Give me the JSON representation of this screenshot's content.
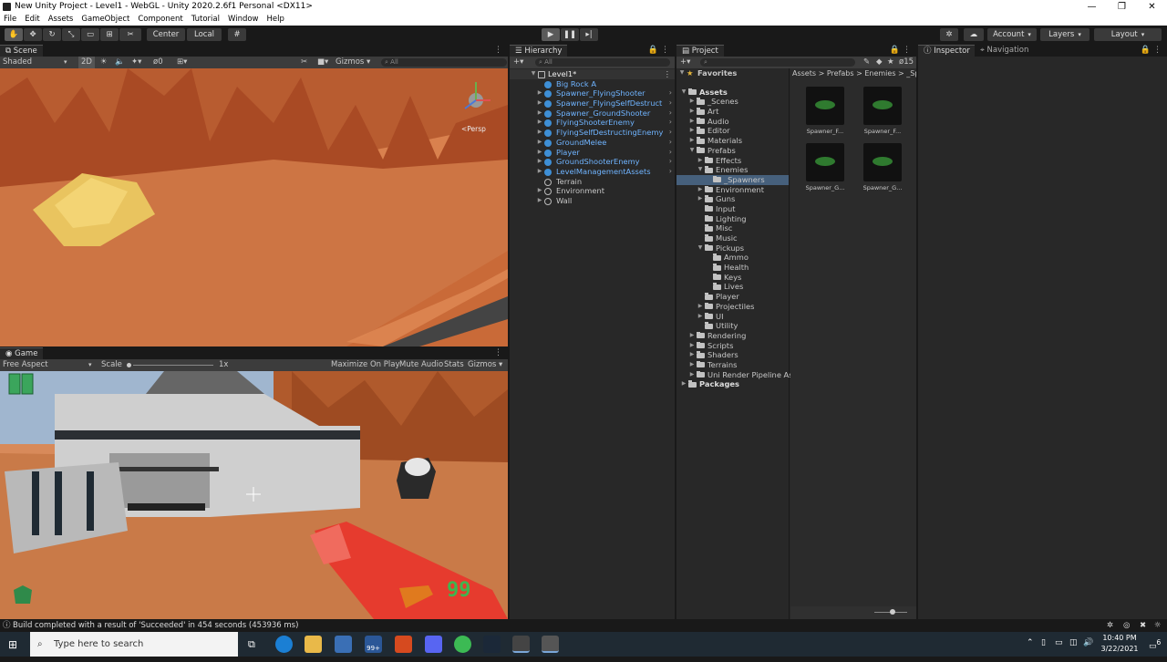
{
  "window": {
    "title": "New Unity Project - Level1 - WebGL - Unity 2020.2.6f1 Personal <DX11>",
    "controls": [
      "—",
      "❐",
      "✕"
    ]
  },
  "menu": [
    "File",
    "Edit",
    "Assets",
    "GameObject",
    "Component",
    "Tutorial",
    "Window",
    "Help"
  ],
  "toolbar": {
    "pivot_center": "Center",
    "pivot_local": "Local",
    "account": "Account",
    "layers": "Layers",
    "layout": "Layout"
  },
  "scene": {
    "tab": "Scene",
    "shading": "Shaded",
    "mode_2d": "2D",
    "hidden_count": "0",
    "gizmos": "Gizmos",
    "search_placeholder": "All",
    "persp": "<Persp"
  },
  "game": {
    "tab": "Game",
    "aspect": "Free Aspect",
    "scale_label": "Scale",
    "scale_value": "1x",
    "maximize": "Maximize On Play",
    "mute": "Mute Audio",
    "stats": "Stats",
    "gizmos": "Gizmos",
    "ammo": "99"
  },
  "hierarchy": {
    "tab": "Hierarchy",
    "search_placeholder": "All",
    "scene": "Level1*",
    "items": [
      {
        "label": "Big Rock A",
        "prefab": true,
        "arrow": false
      },
      {
        "label": "Spawner_FlyingShooter",
        "prefab": true,
        "arrow": true
      },
      {
        "label": "Spawner_FlyingSelfDestruct",
        "prefab": true,
        "arrow": true
      },
      {
        "label": "Spawner_GroundShooter",
        "prefab": true,
        "arrow": true
      },
      {
        "label": "FlyingShooterEnemy",
        "prefab": true,
        "arrow": true
      },
      {
        "label": "FlyingSelfDestructingEnemy",
        "prefab": true,
        "arrow": true
      },
      {
        "label": "GroundMelee",
        "prefab": true,
        "arrow": true
      },
      {
        "label": "Player",
        "prefab": true,
        "arrow": true
      },
      {
        "label": "GroundShooterEnemy",
        "prefab": true,
        "arrow": true
      },
      {
        "label": "LevelManagementAssets",
        "prefab": true,
        "arrow": true
      },
      {
        "label": "Terrain",
        "prefab": false,
        "arrow": false
      },
      {
        "label": "Environment",
        "prefab": false,
        "arrow": true
      },
      {
        "label": "Wall",
        "prefab": false,
        "arrow": true
      }
    ]
  },
  "project": {
    "tab": "Project",
    "hidden_count": "15",
    "favorites": "Favorites",
    "breadcrumb": [
      "Assets",
      "Prefabs",
      "Enemies",
      "_Spa"
    ],
    "tree": [
      {
        "label": "Assets",
        "depth": 0,
        "arrow": "▼",
        "bold": true
      },
      {
        "label": "_Scenes",
        "depth": 1,
        "arrow": "▶"
      },
      {
        "label": "Art",
        "depth": 1,
        "arrow": "▶"
      },
      {
        "label": "Audio",
        "depth": 1,
        "arrow": "▶"
      },
      {
        "label": "Editor",
        "depth": 1,
        "arrow": "▶"
      },
      {
        "label": "Materials",
        "depth": 1,
        "arrow": "▶"
      },
      {
        "label": "Prefabs",
        "depth": 1,
        "arrow": "▼"
      },
      {
        "label": "Effects",
        "depth": 2,
        "arrow": "▶"
      },
      {
        "label": "Enemies",
        "depth": 2,
        "arrow": "▼"
      },
      {
        "label": "_Spawners",
        "depth": 3,
        "arrow": "",
        "selected": true
      },
      {
        "label": "Environment",
        "depth": 2,
        "arrow": "▶"
      },
      {
        "label": "Guns",
        "depth": 2,
        "arrow": "▶"
      },
      {
        "label": "Input",
        "depth": 2,
        "arrow": ""
      },
      {
        "label": "Lighting",
        "depth": 2,
        "arrow": ""
      },
      {
        "label": "Misc",
        "depth": 2,
        "arrow": ""
      },
      {
        "label": "Music",
        "depth": 2,
        "arrow": ""
      },
      {
        "label": "Pickups",
        "depth": 2,
        "arrow": "▼"
      },
      {
        "label": "Ammo",
        "depth": 3,
        "arrow": ""
      },
      {
        "label": "Health",
        "depth": 3,
        "arrow": ""
      },
      {
        "label": "Keys",
        "depth": 3,
        "arrow": ""
      },
      {
        "label": "Lives",
        "depth": 3,
        "arrow": ""
      },
      {
        "label": "Player",
        "depth": 2,
        "arrow": ""
      },
      {
        "label": "Projectiles",
        "depth": 2,
        "arrow": "▶"
      },
      {
        "label": "UI",
        "depth": 2,
        "arrow": "▶"
      },
      {
        "label": "Utility",
        "depth": 2,
        "arrow": ""
      },
      {
        "label": "Rendering",
        "depth": 1,
        "arrow": "▶"
      },
      {
        "label": "Scripts",
        "depth": 1,
        "arrow": "▶"
      },
      {
        "label": "Shaders",
        "depth": 1,
        "arrow": "▶"
      },
      {
        "label": "Terrains",
        "depth": 1,
        "arrow": "▶"
      },
      {
        "label": "Uni Render Pipeline Asse",
        "depth": 1,
        "arrow": "▶"
      },
      {
        "label": "Packages",
        "depth": 0,
        "arrow": "▶",
        "bold": true
      }
    ],
    "assets": [
      "Spawner_F...",
      "Spawner_F...",
      "Spawner_G...",
      "Spawner_G..."
    ]
  },
  "inspector": {
    "tab": "Inspector",
    "tab2": "Navigation"
  },
  "status": "Build completed with a result of 'Succeeded' in 454 seconds (453936 ms)",
  "taskbar": {
    "search_placeholder": "Type here to search",
    "badge": "99+",
    "time": "10:40 PM",
    "date": "3/22/2021",
    "notifications": "6"
  }
}
